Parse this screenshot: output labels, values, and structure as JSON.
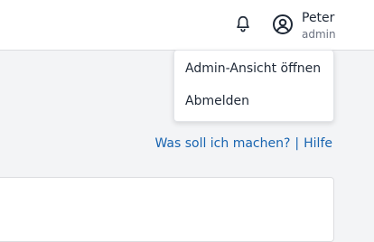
{
  "header": {
    "notifications_icon": "bell-icon",
    "account_icon": "user-circle-icon",
    "user_name": "Peter",
    "user_role": "admin"
  },
  "user_menu": {
    "items": [
      {
        "label": "Admin-Ansicht öffnen"
      },
      {
        "label": "Abmelden"
      }
    ]
  },
  "help": {
    "what_to_do": "Was soll ich machen?",
    "separator": "|",
    "help_link": "Hilfe"
  },
  "colors": {
    "link": "#1864b0",
    "background": "#f3f4f6"
  }
}
